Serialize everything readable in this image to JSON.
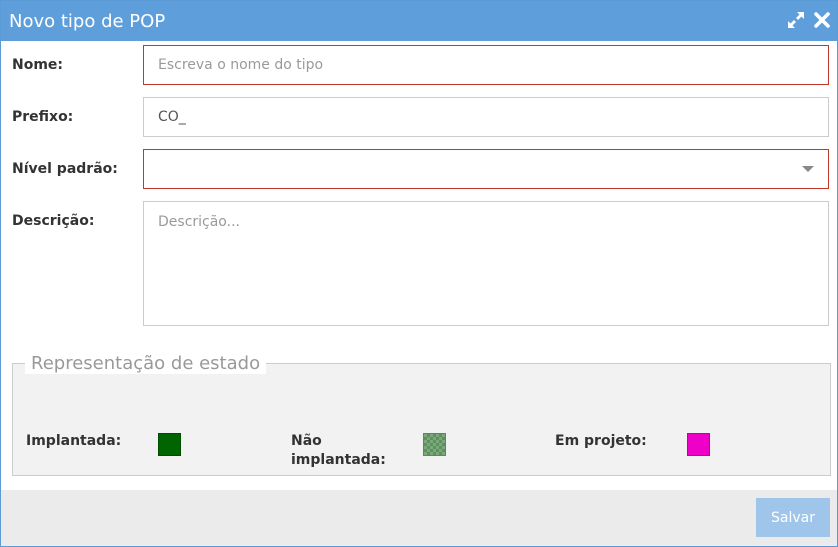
{
  "dialog": {
    "title": "Novo tipo de POP"
  },
  "form": {
    "name": {
      "label": "Nome:",
      "placeholder": "Escreva o nome do tipo",
      "value": ""
    },
    "prefix": {
      "label": "Prefixo:",
      "value": "CO_"
    },
    "level": {
      "label": "Nível padrão:",
      "selected": ""
    },
    "description": {
      "label": "Descrição:",
      "placeholder": "Descrição..."
    }
  },
  "state_representation": {
    "legend": "Representação de estado",
    "items": [
      {
        "label": "Implantada:",
        "color": "#006400"
      },
      {
        "label_line1": "Não",
        "label_line2": "implantada:",
        "color": "#6fa06f",
        "pattern": "checkered"
      },
      {
        "label": "Em projeto:",
        "color": "#ee00c8"
      }
    ]
  },
  "footer": {
    "save_label": "Salvar"
  },
  "icons": {
    "expand": "expand-icon",
    "close": "close-icon",
    "dropdown": "chevron-down-icon"
  }
}
